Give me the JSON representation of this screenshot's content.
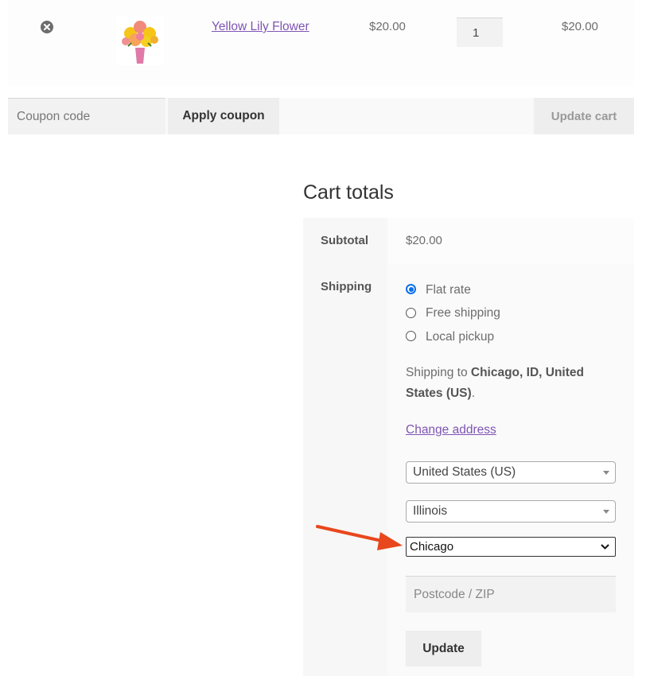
{
  "cart": {
    "item": {
      "name": "Yellow Lily Flower",
      "price": "$20.00",
      "quantity": "1",
      "subtotal": "$20.00",
      "remove_icon": "close-circle-icon",
      "thumbnail": "yellow-lily-bouquet-image"
    },
    "coupon": {
      "placeholder": "Coupon code",
      "apply_label": "Apply coupon"
    },
    "update_cart_label": "Update cart"
  },
  "totals": {
    "title": "Cart totals",
    "subtotal_label": "Subtotal",
    "subtotal_value": "$20.00",
    "shipping_label": "Shipping",
    "shipping_options": [
      {
        "label": "Flat rate",
        "selected": true
      },
      {
        "label": "Free shipping",
        "selected": false
      },
      {
        "label": "Local pickup",
        "selected": false
      }
    ],
    "shipping_to_prefix": "Shipping to ",
    "shipping_to_address": "Chicago, ID, United States (US)",
    "shipping_to_suffix": ".",
    "change_address_label": "Change address",
    "country_value": "United States (US)",
    "state_value": "Illinois",
    "city_value": "Chicago",
    "postcode_placeholder": "Postcode / ZIP",
    "update_label": "Update"
  },
  "colors": {
    "link": "#7f54b3",
    "radio_selected": "#0a70f0",
    "annotation_arrow": "#e8471c"
  }
}
